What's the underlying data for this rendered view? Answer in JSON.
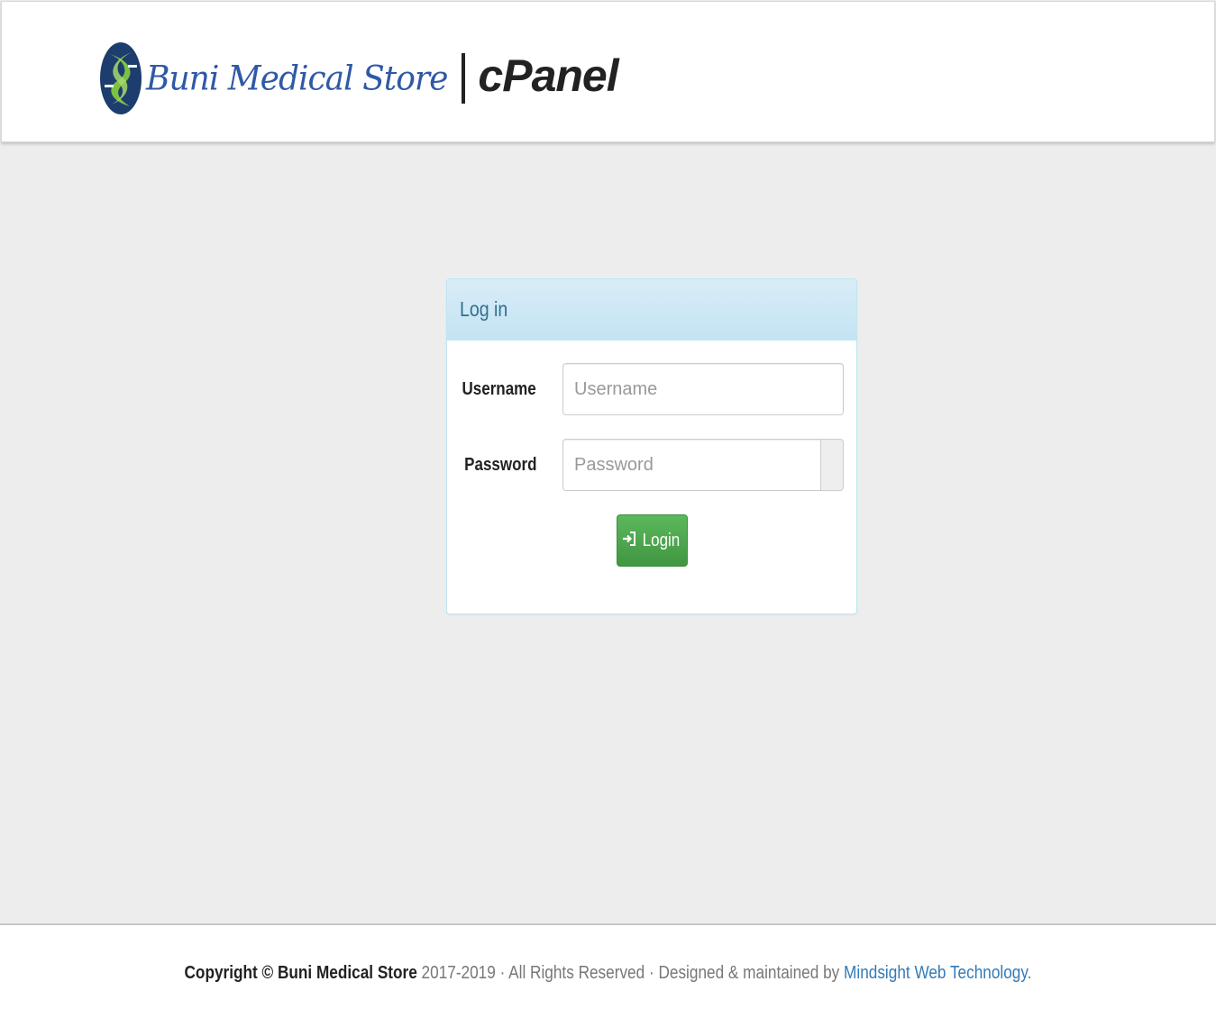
{
  "header": {
    "brand_name": "Buni Medical Store",
    "brand_suffix": "cPanel",
    "logo_icon": "caduceus-leaf-logo-icon"
  },
  "panel": {
    "title": "Log in",
    "username": {
      "label": "Username",
      "placeholder": "Username",
      "value": ""
    },
    "password": {
      "label": "Password",
      "placeholder": "Password",
      "value": ""
    },
    "login_button": {
      "label": "Login",
      "icon": "login-enter-icon"
    }
  },
  "footer": {
    "copyright": "Copyright © Buni Medical Store",
    "years": " 2017-2019 · All Rights Reserved · Designed & maintained by ",
    "designer": "Mindsight Web Technology",
    "trailing": "."
  },
  "colors": {
    "background": "#ededed",
    "brand_blue": "#2f59a6",
    "panel_heading": "#d9edf7",
    "login_green": "#5cb85c",
    "link": "#337ab7"
  }
}
